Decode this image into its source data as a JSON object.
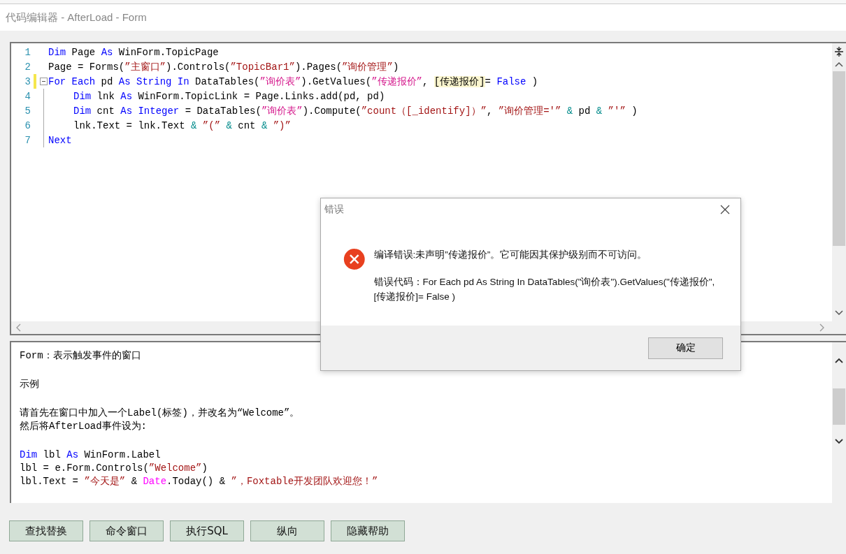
{
  "window": {
    "title": "代码编辑器 - AfterLoad - Form"
  },
  "editor": {
    "lines": [
      {
        "number": "1",
        "modified": false,
        "foldable": false,
        "indent": false,
        "tokens": [
          {
            "kind": "kw",
            "text": "Dim"
          },
          {
            "kind": "plain",
            "text": " Page "
          },
          {
            "kind": "kw",
            "text": "As"
          },
          {
            "kind": "plain",
            "text": " WinForm.TopicPage"
          }
        ]
      },
      {
        "number": "2",
        "modified": false,
        "foldable": false,
        "indent": false,
        "tokens": [
          {
            "kind": "plain",
            "text": "Page = Forms("
          },
          {
            "kind": "str",
            "text": "”主窗口”"
          },
          {
            "kind": "plain",
            "text": ").Controls("
          },
          {
            "kind": "str",
            "text": "”TopicBar1”"
          },
          {
            "kind": "plain",
            "text": ").Pages("
          },
          {
            "kind": "str",
            "text": "”询价管理”"
          },
          {
            "kind": "plain",
            "text": ")"
          }
        ]
      },
      {
        "number": "3",
        "modified": true,
        "foldable": true,
        "indent": false,
        "tokens": [
          {
            "kind": "kw",
            "text": "For Each"
          },
          {
            "kind": "plain",
            "text": " pd "
          },
          {
            "kind": "kw",
            "text": "As String In"
          },
          {
            "kind": "plain",
            "text": " DataTables("
          },
          {
            "kind": "str2",
            "text": "”询价表”"
          },
          {
            "kind": "plain",
            "text": ").GetValues("
          },
          {
            "kind": "str2",
            "text": "”传递报价”"
          },
          {
            "kind": "plain",
            "text": ", "
          },
          {
            "kind": "hl",
            "text": "[传递报价]"
          },
          {
            "kind": "plain",
            "text": "= "
          },
          {
            "kind": "kw",
            "text": "False"
          },
          {
            "kind": "plain",
            "text": " )"
          }
        ]
      },
      {
        "number": "4",
        "modified": false,
        "foldable": false,
        "indent": true,
        "tokens": [
          {
            "kind": "kw",
            "text": "Dim"
          },
          {
            "kind": "plain",
            "text": " lnk "
          },
          {
            "kind": "kw",
            "text": "As"
          },
          {
            "kind": "plain",
            "text": " WinForm.TopicLink = Page.Links.add(pd, pd)"
          }
        ]
      },
      {
        "number": "5",
        "modified": false,
        "foldable": false,
        "indent": true,
        "tokens": [
          {
            "kind": "kw",
            "text": "Dim"
          },
          {
            "kind": "plain",
            "text": " cnt "
          },
          {
            "kind": "kw",
            "text": "As Integer"
          },
          {
            "kind": "plain",
            "text": " = DataTables("
          },
          {
            "kind": "str2",
            "text": "”询价表”"
          },
          {
            "kind": "plain",
            "text": ").Compute("
          },
          {
            "kind": "str",
            "text": "”count（[_identify]）”"
          },
          {
            "kind": "plain",
            "text": ", "
          },
          {
            "kind": "str",
            "text": "”询价管理='”"
          },
          {
            "kind": "op",
            "text": " &"
          },
          {
            "kind": "plain",
            "text": " pd "
          },
          {
            "kind": "op",
            "text": "&"
          },
          {
            "kind": "str",
            "text": " ”'”"
          },
          {
            "kind": "plain",
            "text": " )"
          }
        ]
      },
      {
        "number": "6",
        "modified": false,
        "foldable": false,
        "indent": true,
        "tokens": [
          {
            "kind": "plain",
            "text": "lnk.Text = lnk.Text "
          },
          {
            "kind": "op",
            "text": "&"
          },
          {
            "kind": "str",
            "text": " ”(”"
          },
          {
            "kind": "op",
            "text": " &"
          },
          {
            "kind": "plain",
            "text": " cnt "
          },
          {
            "kind": "op",
            "text": "&"
          },
          {
            "kind": "str",
            "text": " ”)”"
          }
        ]
      },
      {
        "number": "7",
        "modified": false,
        "foldable": false,
        "indent": false,
        "tokens": [
          {
            "kind": "kw",
            "text": "Next"
          }
        ]
      }
    ]
  },
  "help": {
    "blocks": [
      [
        [
          {
            "kind": "plain",
            "text": "Form：表示触发事件的窗口"
          }
        ]
      ],
      [
        [
          {
            "kind": "plain",
            "text": "示例"
          }
        ]
      ],
      [
        [
          {
            "kind": "plain",
            "text": "请首先在窗口中加入一个Label(标签)，并改名为“Welcome”。"
          }
        ],
        [
          {
            "kind": "plain",
            "text": "然后将AfterLoad事件设为:"
          }
        ]
      ],
      [
        [
          {
            "kind": "kw",
            "text": "Dim"
          },
          {
            "kind": "plain",
            "text": " lbl "
          },
          {
            "kind": "kw",
            "text": "As"
          },
          {
            "kind": "plain",
            "text": " WinForm.Label"
          }
        ],
        [
          {
            "kind": "plain",
            "text": "lbl = e.Form.Controls("
          },
          {
            "kind": "str",
            "text": "”Welcome”"
          },
          {
            "kind": "plain",
            "text": ")"
          }
        ],
        [
          {
            "kind": "plain",
            "text": "lbl.Text = "
          },
          {
            "kind": "str",
            "text": "”今天是”"
          },
          {
            "kind": "plain",
            "text": " & "
          },
          {
            "kind": "fn",
            "text": "Date"
          },
          {
            "kind": "plain",
            "text": ".Today() & "
          },
          {
            "kind": "str",
            "text": "”，Foxtable开发团队欢迎您！”"
          }
        ]
      ]
    ]
  },
  "buttons": [
    "查找替换",
    "命令窗口",
    "执行SQL",
    "纵向",
    "隐藏帮助"
  ],
  "dialog": {
    "title": "错误",
    "message": "编译错误:未声明”传递报价”。它可能因其保护级别而不可访问。",
    "detail": "错误代码：For Each pd As String In DataTables(\"询价表\").GetValues(\"传递报价\", [传递报价]= False )",
    "button": "确定"
  }
}
